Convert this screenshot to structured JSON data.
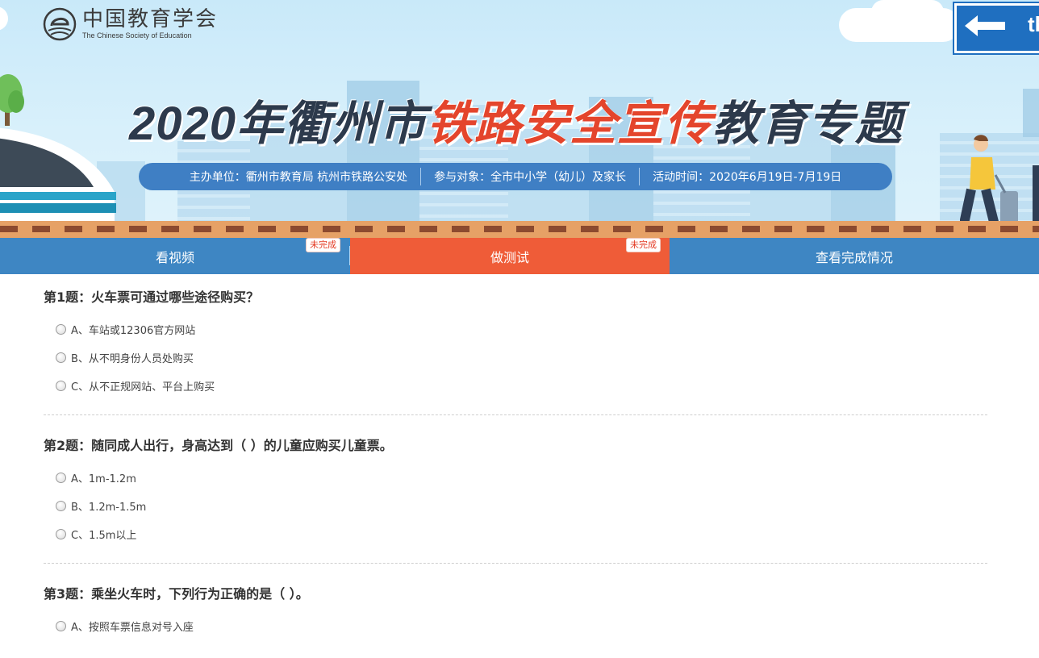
{
  "banner": {
    "logo_cn": "中国教育学会",
    "logo_en": "The Chinese Society of Education",
    "sign_text": "th",
    "title_part1": "2020年衢州市",
    "title_part2": "铁路安全宣传",
    "title_part3": "教育专题",
    "info": [
      "主办单位：衢州市教育局 杭州市铁路公安处",
      "参与对象：全市中小学（幼儿）及家长",
      "活动时间：2020年6月19日-7月19日"
    ],
    "colors": {
      "title_dark": "#2d3a4c",
      "title_red": "#e4452c",
      "pill": "#3f7fc4"
    }
  },
  "nav": {
    "tabs": [
      {
        "label": "看视频",
        "badge": "未完成",
        "active": false
      },
      {
        "label": "做测试",
        "badge": "未完成",
        "active": true
      },
      {
        "label": "查看完成情况",
        "badge": "",
        "active": false
      }
    ],
    "colors": {
      "bar": "#3e86c3",
      "active": "#ef5c38"
    }
  },
  "questions": [
    {
      "title": "第1题：火车票可通过哪些途径购买？",
      "options": [
        "A、车站或12306官方网站",
        "B、从不明身份人员处购买",
        "C、从不正规网站、平台上购买"
      ]
    },
    {
      "title": "第2题：随同成人出行，身高达到（ ）的儿童应购买儿童票。",
      "options": [
        "A、1m-1.2m",
        "B、1.2m-1.5m",
        "C、1.5m以上"
      ]
    },
    {
      "title": "第3题：乘坐火车时，下列行为正确的是（ ）。",
      "options": [
        "A、按照车票信息对号入座"
      ]
    }
  ]
}
